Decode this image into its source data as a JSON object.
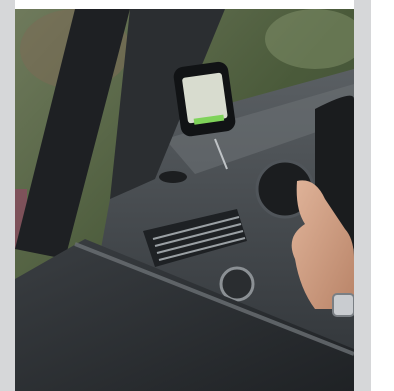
{
  "image": {
    "subject": "car-phone-navigation-photo",
    "colors": {
      "bg_band": "#d6d7d9",
      "foliage": "#4a5a3a",
      "dash": "#2f3337",
      "door": "#2a2d30",
      "hand": "#c99a80",
      "screen": "#d8dccf",
      "accent": "#7fd35a"
    }
  }
}
